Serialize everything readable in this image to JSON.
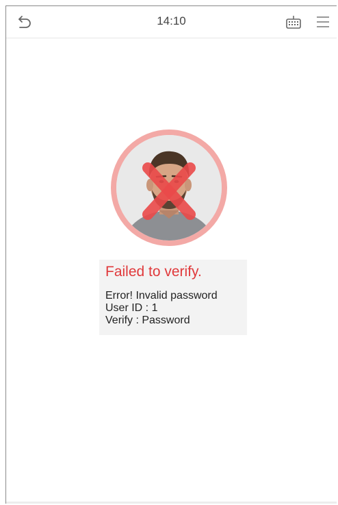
{
  "status_bar": {
    "time": "14:10",
    "back_icon": "back-arrow-icon",
    "keyboard_icon": "keyboard-icon",
    "menu_icon": "hamburger-menu-icon"
  },
  "avatar": {
    "overlay_icon": "x-mark-icon"
  },
  "result": {
    "title": "Failed to verify.",
    "error": "Error! Invalid password",
    "user_id": "User ID : 1",
    "verify": "Verify : Password"
  },
  "colors": {
    "error_red": "#e0393b",
    "ring_pink": "#f3a9a6"
  }
}
